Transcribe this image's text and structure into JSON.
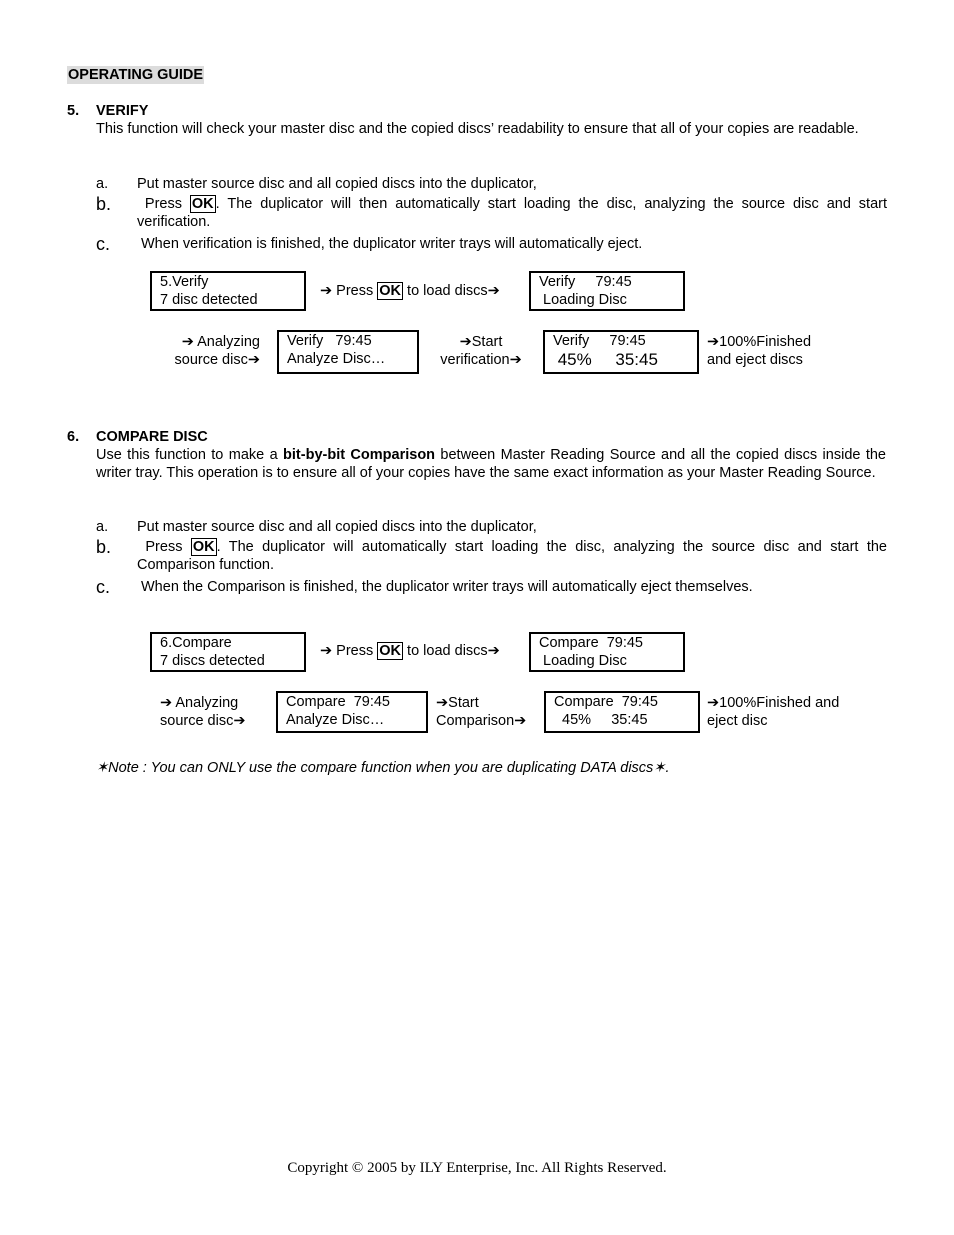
{
  "document": {
    "heading": "OPERATING GUIDE",
    "sections": [
      {
        "number": "5.",
        "title": "VERIFY",
        "intro": "This function will check your master disc and the copied discs’ readability to ensure that all of your copies are readable.",
        "steps": [
          {
            "letter": "a.",
            "text": "Put master source disc and all copied discs into the duplicator,"
          },
          {
            "letter": "b.",
            "pre": "Press ",
            "key": "OK",
            "text": ".  The duplicator will then automatically start loading the disc, analyzing the source disc and start verification."
          },
          {
            "letter": "c.",
            "text": "When verification is finished, the duplicator writer trays will automatically eject."
          }
        ],
        "flow": {
          "lcd1": [
            "5.Verify",
            "7 disc detected"
          ],
          "step1_pre": "➔ Press ",
          "step1_key": "OK",
          "step1_post": " to load discs➔",
          "lcd2": [
            "Verify     79:45",
            " Loading Disc"
          ],
          "step2": [
            "➔ Analyzing",
            "source disc➔"
          ],
          "lcd3": [
            "Verify   79:45",
            "Analyze Disc…"
          ],
          "step3": [
            "➔Start",
            "verification➔"
          ],
          "lcd4": [
            "Verify     79:45",
            " 45%",
            "35:45"
          ],
          "step4": [
            "➔100%Finished",
            "and eject discs"
          ]
        }
      },
      {
        "number": "6.",
        "title": "COMPARE DISC",
        "intro_pre": "Use this function to make a ",
        "intro_bold": "bit-by-bit Comparison",
        "intro_post": " between Master Reading Source and all the copied discs inside the writer tray. This operation is to ensure all of your copies have the same exact information as your Master Reading Source.",
        "steps": [
          {
            "letter": "a.",
            "text": "Put master source disc and all copied discs into the duplicator,"
          },
          {
            "letter": "b.",
            "pre": "Press ",
            "key": "OK",
            "text": ".  The duplicator will automatically start loading the disc, analyzing the source disc and start the Comparison function."
          },
          {
            "letter": "c.",
            "text": "When the Comparison is finished, the duplicator writer trays will automatically eject themselves."
          }
        ],
        "flow": {
          "lcd1": [
            "6.Compare",
            "7 discs detected"
          ],
          "step1_pre": "➔ Press ",
          "step1_key": "OK",
          "step1_post": " to load discs➔",
          "lcd2": [
            "Compare  79:45",
            " Loading Disc"
          ],
          "step2": [
            "➔ Analyzing",
            "source disc➔"
          ],
          "lcd3": [
            "Compare  79:45",
            "Analyze Disc…"
          ],
          "step3": [
            "➔Start",
            "Comparison➔"
          ],
          "lcd4": [
            "Compare  79:45",
            "  45%     35:45"
          ],
          "step4": [
            "➔100%Finished and",
            "eject disc"
          ]
        }
      }
    ],
    "note": "✶Note :  You can ONLY use the compare function when you are duplicating DATA discs✶.",
    "copyright": "Copyright © 2005 by ILY Enterprise, Inc. All Rights Reserved."
  }
}
